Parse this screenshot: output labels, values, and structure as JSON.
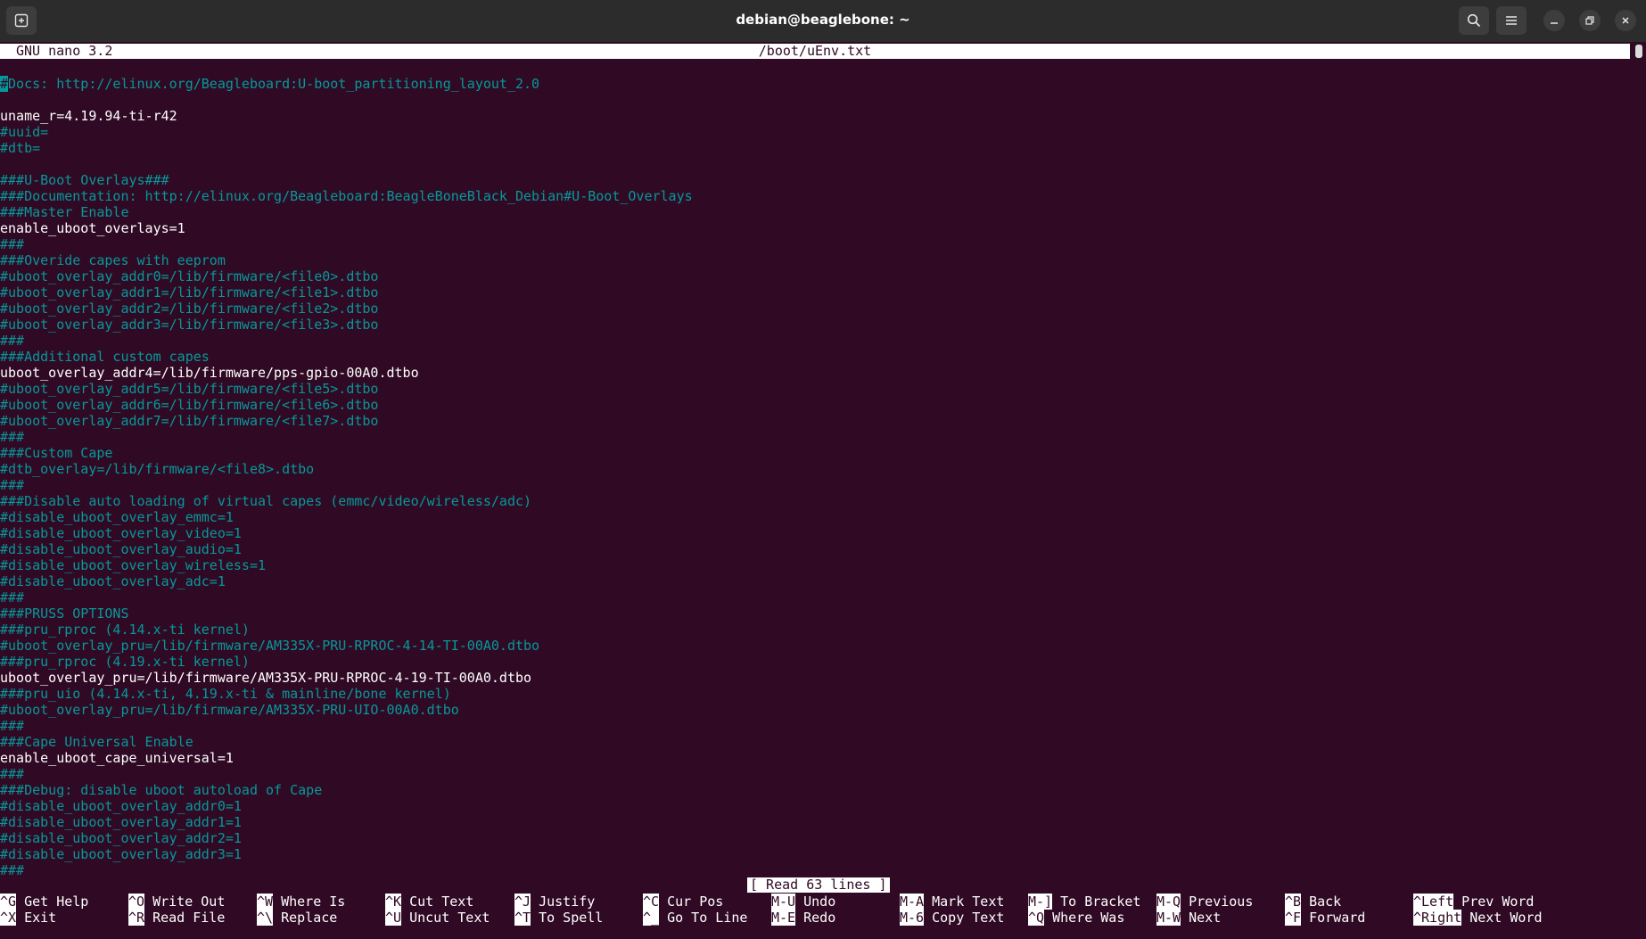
{
  "window": {
    "title": "debian@beaglebone: ~"
  },
  "nano": {
    "version": "GNU nano 3.2",
    "filename": "/boot/uEnv.txt",
    "status": "[ Read 63 lines ]"
  },
  "colors": {
    "background": "#300a24",
    "comment": "#06989a",
    "text": "#ffffff"
  },
  "lines": [
    {
      "text": "#Docs: http://elinux.org/Beagleboard:U-boot_partitioning_layout_2.0",
      "type": "c"
    },
    {
      "text": "",
      "type": "n"
    },
    {
      "text": "uname_r=4.19.94-ti-r42",
      "type": "n"
    },
    {
      "text": "#uuid=",
      "type": "c"
    },
    {
      "text": "#dtb=",
      "type": "c"
    },
    {
      "text": "",
      "type": "n"
    },
    {
      "text": "###U-Boot Overlays###",
      "type": "c"
    },
    {
      "text": "###Documentation: http://elinux.org/Beagleboard:BeagleBoneBlack_Debian#U-Boot_Overlays",
      "type": "c"
    },
    {
      "text": "###Master Enable",
      "type": "c"
    },
    {
      "text": "enable_uboot_overlays=1",
      "type": "n"
    },
    {
      "text": "###",
      "type": "c"
    },
    {
      "text": "###Overide capes with eeprom",
      "type": "c"
    },
    {
      "text": "#uboot_overlay_addr0=/lib/firmware/<file0>.dtbo",
      "type": "c"
    },
    {
      "text": "#uboot_overlay_addr1=/lib/firmware/<file1>.dtbo",
      "type": "c"
    },
    {
      "text": "#uboot_overlay_addr2=/lib/firmware/<file2>.dtbo",
      "type": "c"
    },
    {
      "text": "#uboot_overlay_addr3=/lib/firmware/<file3>.dtbo",
      "type": "c"
    },
    {
      "text": "###",
      "type": "c"
    },
    {
      "text": "###Additional custom capes",
      "type": "c"
    },
    {
      "text": "uboot_overlay_addr4=/lib/firmware/pps-gpio-00A0.dtbo",
      "type": "n"
    },
    {
      "text": "#uboot_overlay_addr5=/lib/firmware/<file5>.dtbo",
      "type": "c"
    },
    {
      "text": "#uboot_overlay_addr6=/lib/firmware/<file6>.dtbo",
      "type": "c"
    },
    {
      "text": "#uboot_overlay_addr7=/lib/firmware/<file7>.dtbo",
      "type": "c"
    },
    {
      "text": "###",
      "type": "c"
    },
    {
      "text": "###Custom Cape",
      "type": "c"
    },
    {
      "text": "#dtb_overlay=/lib/firmware/<file8>.dtbo",
      "type": "c"
    },
    {
      "text": "###",
      "type": "c"
    },
    {
      "text": "###Disable auto loading of virtual capes (emmc/video/wireless/adc)",
      "type": "c"
    },
    {
      "text": "#disable_uboot_overlay_emmc=1",
      "type": "c"
    },
    {
      "text": "#disable_uboot_overlay_video=1",
      "type": "c"
    },
    {
      "text": "#disable_uboot_overlay_audio=1",
      "type": "c"
    },
    {
      "text": "#disable_uboot_overlay_wireless=1",
      "type": "c"
    },
    {
      "text": "#disable_uboot_overlay_adc=1",
      "type": "c"
    },
    {
      "text": "###",
      "type": "c"
    },
    {
      "text": "###PRUSS OPTIONS",
      "type": "c"
    },
    {
      "text": "###pru_rproc (4.14.x-ti kernel)",
      "type": "c"
    },
    {
      "text": "#uboot_overlay_pru=/lib/firmware/AM335X-PRU-RPROC-4-14-TI-00A0.dtbo",
      "type": "c"
    },
    {
      "text": "###pru_rproc (4.19.x-ti kernel)",
      "type": "c"
    },
    {
      "text": "uboot_overlay_pru=/lib/firmware/AM335X-PRU-RPROC-4-19-TI-00A0.dtbo",
      "type": "n"
    },
    {
      "text": "###pru_uio (4.14.x-ti, 4.19.x-ti & mainline/bone kernel)",
      "type": "c"
    },
    {
      "text": "#uboot_overlay_pru=/lib/firmware/AM335X-PRU-UIO-00A0.dtbo",
      "type": "c"
    },
    {
      "text": "###",
      "type": "c"
    },
    {
      "text": "###Cape Universal Enable",
      "type": "c"
    },
    {
      "text": "enable_uboot_cape_universal=1",
      "type": "n"
    },
    {
      "text": "###",
      "type": "c"
    },
    {
      "text": "###Debug: disable uboot autoload of Cape",
      "type": "c"
    },
    {
      "text": "#disable_uboot_overlay_addr0=1",
      "type": "c"
    },
    {
      "text": "#disable_uboot_overlay_addr1=1",
      "type": "c"
    },
    {
      "text": "#disable_uboot_overlay_addr2=1",
      "type": "c"
    },
    {
      "text": "#disable_uboot_overlay_addr3=1",
      "type": "c"
    },
    {
      "text": "###",
      "type": "c"
    }
  ],
  "shortcuts_row1": [
    {
      "key": "^G",
      "label": "Get Help"
    },
    {
      "key": "^O",
      "label": "Write Out"
    },
    {
      "key": "^W",
      "label": "Where Is"
    },
    {
      "key": "^K",
      "label": "Cut Text"
    },
    {
      "key": "^J",
      "label": "Justify"
    },
    {
      "key": "^C",
      "label": "Cur Pos"
    },
    {
      "key": "M-U",
      "label": "Undo"
    },
    {
      "key": "M-A",
      "label": "Mark Text"
    },
    {
      "key": "M-]",
      "label": "To Bracket"
    },
    {
      "key": "M-Q",
      "label": "Previous"
    },
    {
      "key": "^B",
      "label": "Back"
    },
    {
      "key": "^Left",
      "label": "Prev Word"
    }
  ],
  "shortcuts_row2": [
    {
      "key": "^X",
      "label": "Exit"
    },
    {
      "key": "^R",
      "label": "Read File"
    },
    {
      "key": "^\\",
      "label": "Replace"
    },
    {
      "key": "^U",
      "label": "Uncut Text"
    },
    {
      "key": "^T",
      "label": "To Spell"
    },
    {
      "key": "^_",
      "label": "Go To Line"
    },
    {
      "key": "M-E",
      "label": "Redo"
    },
    {
      "key": "M-6",
      "label": "Copy Text"
    },
    {
      "key": "^Q",
      "label": "Where Was"
    },
    {
      "key": "M-W",
      "label": "Next"
    },
    {
      "key": "^F",
      "label": "Forward"
    },
    {
      "key": "^Right",
      "label": "Next Word"
    }
  ]
}
